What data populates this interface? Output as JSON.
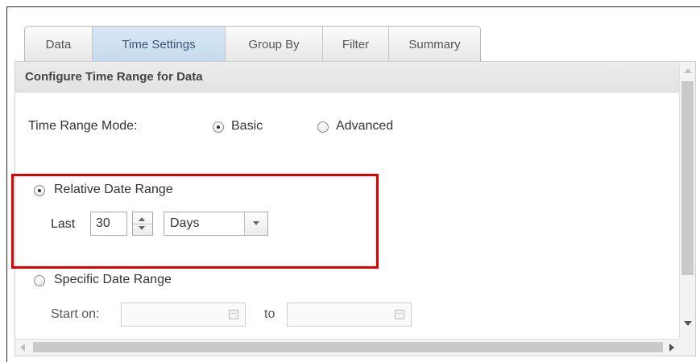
{
  "tabs": [
    {
      "label": "Data",
      "active": false
    },
    {
      "label": "Time Settings",
      "active": true
    },
    {
      "label": "Group By",
      "active": false
    },
    {
      "label": "Filter",
      "active": false
    },
    {
      "label": "Summary",
      "active": false
    }
  ],
  "panel": {
    "title": "Configure Time Range for Data"
  },
  "time_range_mode": {
    "label": "Time Range Mode:",
    "options": [
      "Basic",
      "Advanced"
    ],
    "selected": "Basic"
  },
  "relative": {
    "label": "Relative Date Range",
    "selected": true,
    "last_label": "Last",
    "value": "30",
    "unit": "Days"
  },
  "specific": {
    "label": "Specific Date Range",
    "selected": false,
    "start_label": "Start on:",
    "to_label": "to",
    "start_value": "",
    "end_value": ""
  },
  "colors": {
    "highlight": "#e00000",
    "active_tab": "#c6dbee"
  },
  "icons": [
    "radio-button-icon",
    "spinner-up-icon",
    "spinner-down-icon",
    "dropdown-arrow-icon",
    "calendar-icon",
    "scroll-arrow-icon"
  ]
}
